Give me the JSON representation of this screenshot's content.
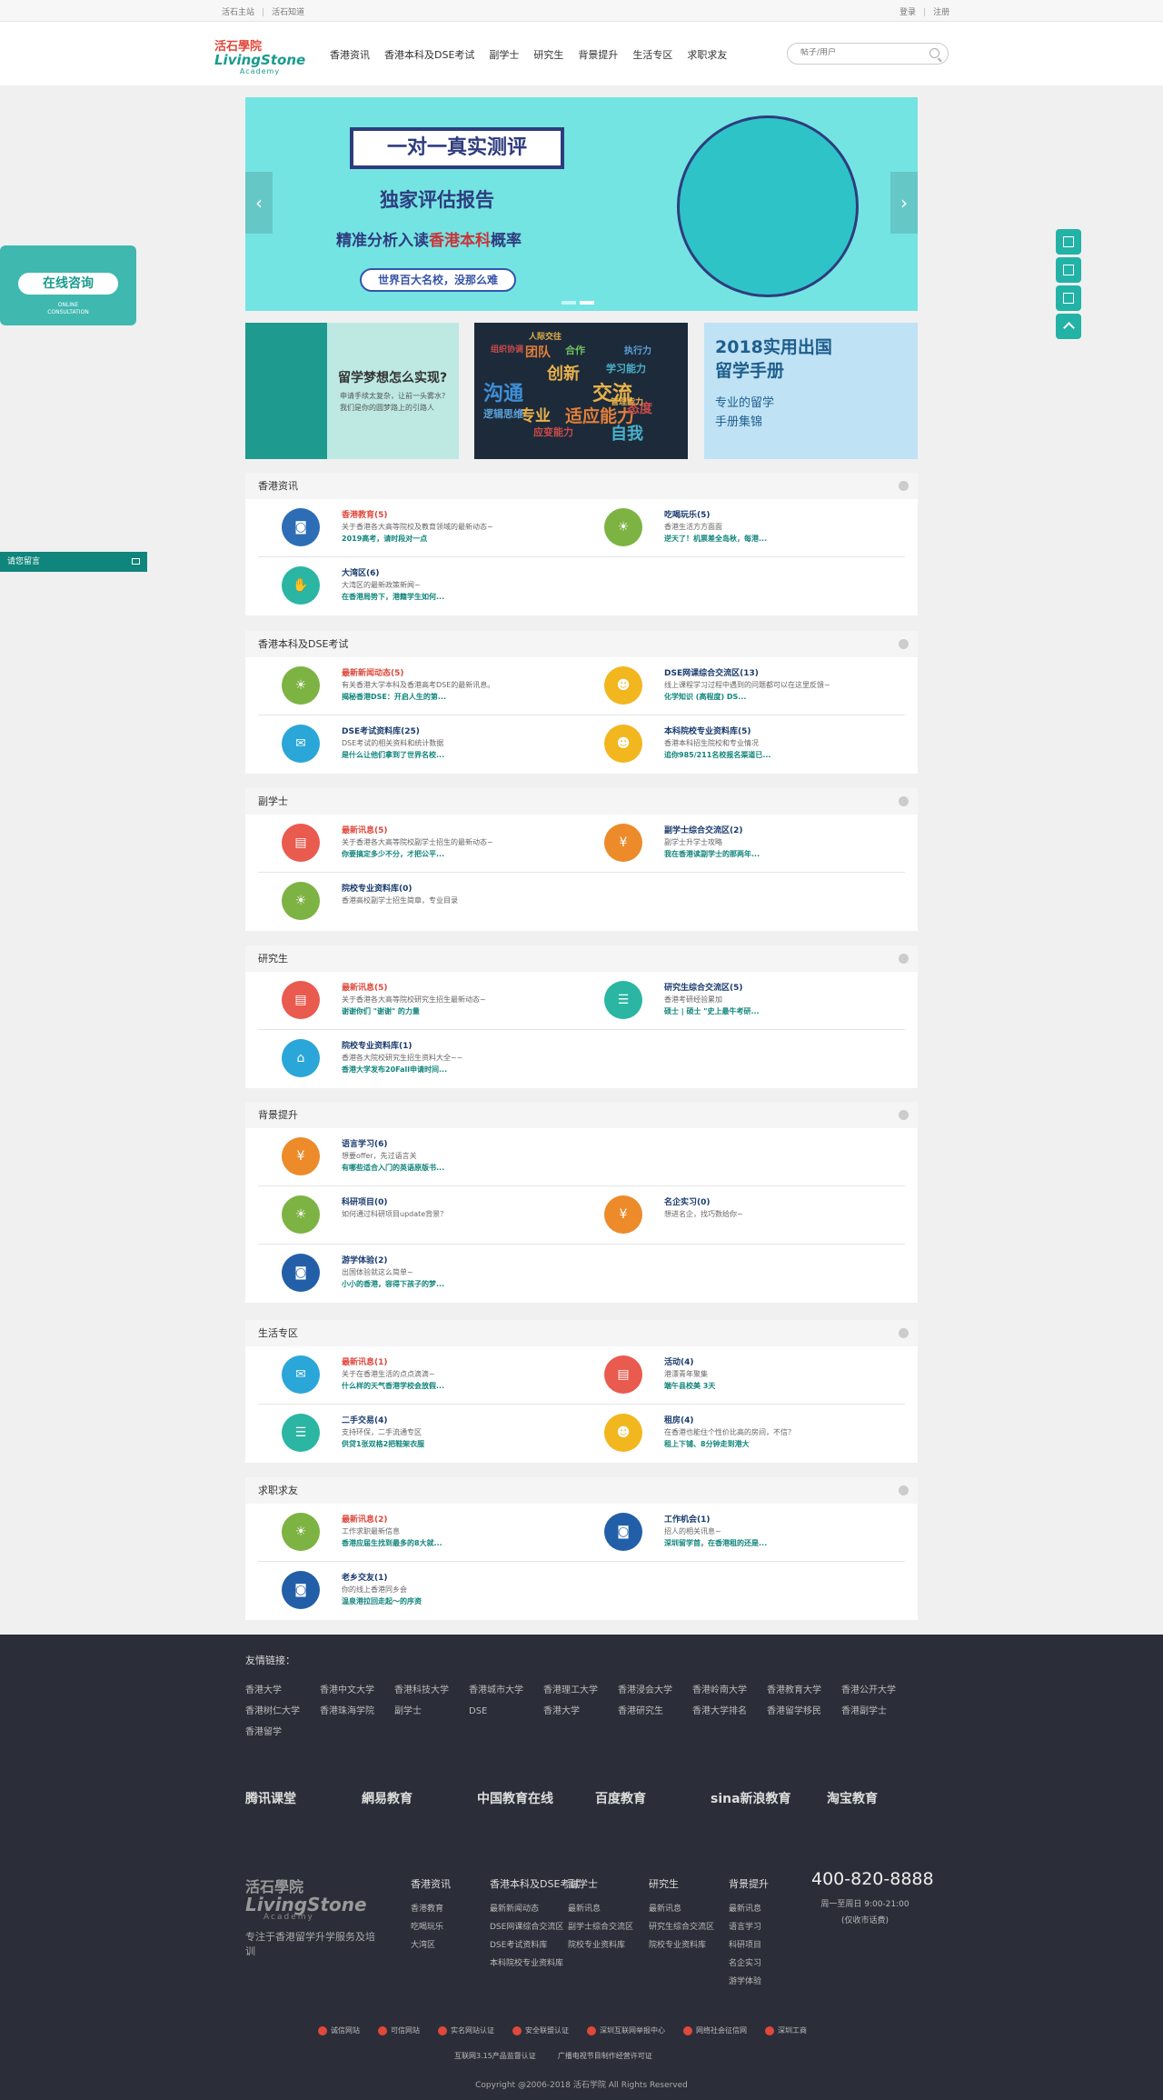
{
  "topbar": {
    "left1": "活石主站",
    "left2": "活石知道",
    "login": "登录",
    "register": "注册"
  },
  "logo": {
    "line1": "活石學院",
    "line2": "LivingStone",
    "line3": "Academy"
  },
  "nav": [
    "香港资讯",
    "香港本科及DSE考试",
    "副学士",
    "研究生",
    "背景提升",
    "生活专区",
    "求职求友"
  ],
  "search": {
    "placeholder": "帖子/用户"
  },
  "banner": {
    "title": "一对一真实测评",
    "line2": "独家评估报告",
    "line3_a": "精准分析入读",
    "line3_b": "香港本科",
    "line3_c": "概率",
    "button": "世界百大名校，没那么难"
  },
  "cards": {
    "card1_title": "留学梦想怎么实现?",
    "card1_desc": "申请手续太复杂，让前一头雾水?我们是你的圆梦路上的引路人",
    "card2_words": [
      "人际交往",
      "组织协调",
      "团队",
      "执行力",
      "创新",
      "学习能力",
      "沟通",
      "交流",
      "专业",
      "适应能力",
      "态度",
      "自我",
      "逻辑思维",
      "管理能力",
      "应变能力",
      "合作"
    ],
    "card3_t1": "2018实用出国",
    "card3_t2": "留学手册",
    "card3_t3": "专业的留学",
    "card3_t4": "手册集锦"
  },
  "side": {
    "consult": "在线咨询",
    "consult_sub1": "ONLINE",
    "consult_sub2": "CONSULTATION",
    "msg": "请您留言"
  },
  "sections": [
    {
      "title": "香港资讯",
      "rows": [
        [
          {
            "title": "香港教育(5)",
            "red": true,
            "desc": "关于香港各大高等院校及教育领域的最新动态~",
            "link": "2019高考，请时段对一点",
            "color": "c-blue",
            "icon": "◙"
          },
          {
            "title": "吃喝玩乐(5)",
            "red": false,
            "desc": "香港生活方方面面",
            "link": "逆天了！机票差全岛秋，每港...",
            "color": "c-green",
            "icon": "☀"
          }
        ],
        [
          {
            "title": "大湾区(6)",
            "red": false,
            "desc": "大湾区的最新政策新闻~",
            "link": "在香港局势下，港籍学生如何...",
            "color": "c-teal",
            "icon": "✋"
          }
        ]
      ]
    },
    {
      "title": "香港本科及DSE考试",
      "rows": [
        [
          {
            "title": "最新新闻动态(5)",
            "red": true,
            "desc": "有关香港大学本科及香港高考DSE的最新讯息。",
            "link": "揭秘香港DSE：开启人生的第...",
            "color": "c-green",
            "icon": "☀"
          },
          {
            "title": "DSE网课综合交流区(13)",
            "red": false,
            "desc": "线上课程学习过程中遇到的问题都可以在这里反馈~",
            "link": "化学知识 (高程度) DS...",
            "color": "c-yellow",
            "icon": "☻"
          }
        ],
        [
          {
            "title": "DSE考试资料库(25)",
            "red": false,
            "desc": "DSE考试的相关资料和统计数据",
            "link": "是什么让他们拿到了世界名校...",
            "color": "c-cyan",
            "icon": "✉"
          },
          {
            "title": "本科院校专业资料库(5)",
            "red": false,
            "desc": "香港本科招生院校和专业情况",
            "link": "追你985/211名校报名渠道已...",
            "color": "c-yellow",
            "icon": "☻"
          }
        ]
      ]
    },
    {
      "title": "副学士",
      "rows": [
        [
          {
            "title": "最新讯息(5)",
            "red": true,
            "desc": "关于香港各大高等院校副学士招生的最新动态~",
            "link": "你要搞定多少不分，才把公平...",
            "color": "c-red",
            "icon": "▤"
          },
          {
            "title": "副学士综合交流区(2)",
            "red": false,
            "desc": "副学士升学士攻略",
            "link": "我在香港读副学士的那两年...",
            "color": "c-orange",
            "icon": "¥"
          }
        ],
        [
          {
            "title": "院校专业资料库(0)",
            "red": false,
            "desc": "香港高校副学士招生简章，专业目录",
            "link": "",
            "color": "c-green",
            "icon": "☀"
          }
        ]
      ]
    },
    {
      "title": "研究生",
      "rows": [
        [
          {
            "title": "最新讯息(5)",
            "red": true,
            "desc": "关于香港各大高等院校研究生招生最新动态~",
            "link": "谢谢你们 \"谢谢\" 的力量",
            "color": "c-red",
            "icon": "▤"
          },
          {
            "title": "研究生综合交流区(5)",
            "red": false,
            "desc": "香港考研经验累加",
            "link": "硕士 | 硕士 \"史上最牛考研...",
            "color": "c-teal",
            "icon": "☰"
          }
        ],
        [
          {
            "title": "院校专业资料库(1)",
            "red": false,
            "desc": "香港各大院校研究生招生资料大全~~",
            "link": "香港大学发布20Fall申请时间...",
            "color": "c-cyan",
            "icon": "⌂"
          }
        ]
      ]
    },
    {
      "title": "背景提升",
      "rows": [
        [
          {
            "title": "语言学习(6)",
            "red": false,
            "desc": "想要offer，先过语言关",
            "link": "有哪些适合入门的英语原版书...",
            "color": "c-orange",
            "icon": "¥"
          }
        ],
        [
          {
            "title": "科研项目(0)",
            "red": false,
            "desc": "如何通过科研项目update背景？",
            "link": "",
            "color": "c-green",
            "icon": "☀"
          },
          {
            "title": "名企实习(0)",
            "red": false,
            "desc": "想进名企，找巧数给你~",
            "link": "",
            "color": "c-orange",
            "icon": "¥"
          }
        ],
        [
          {
            "title": "游学体验(2)",
            "red": false,
            "desc": "出国体验就这么简单~",
            "link": "小小的香港，容得下孩子的梦...",
            "color": "c-dblue",
            "icon": "◙"
          }
        ]
      ]
    },
    {
      "title": "生活专区",
      "rows": [
        [
          {
            "title": "最新讯息(1)",
            "red": true,
            "desc": "关于在香港生活的点点滴滴~",
            "link": "什么样的天气香港学校会放假...",
            "color": "c-cyan",
            "icon": "✉"
          },
          {
            "title": "活动(4)",
            "red": false,
            "desc": "港漂青年聚集",
            "link": "端午县校美 3天",
            "color": "c-red",
            "icon": "▤"
          }
        ],
        [
          {
            "title": "二手交易(4)",
            "red": false,
            "desc": "支持环保，二手流通专区",
            "link": "供贷1张双格2把鞋架衣服",
            "color": "c-teal",
            "icon": "☰"
          },
          {
            "title": "租房(4)",
            "red": false,
            "desc": "在香港也能住个性价比高的房间，不信？",
            "link": "租上下铺、8分钟走到港大",
            "color": "c-yellow",
            "icon": "☻"
          }
        ]
      ]
    },
    {
      "title": "求职求友",
      "rows": [
        [
          {
            "title": "最新讯息(2)",
            "red": true,
            "desc": "工作求职最新信息",
            "link": "香港应届生找到最多的8大就...",
            "color": "c-green",
            "icon": "☀"
          },
          {
            "title": "工作机会(1)",
            "red": false,
            "desc": "招人的相关讯息~",
            "link": "深圳留学首，在香港租的还是...",
            "color": "c-dblue",
            "icon": "◙"
          }
        ],
        [
          {
            "title": "老乡交友(1)",
            "red": false,
            "desc": "你的线上香港同乡会",
            "link": "温泉港拉回走起～的序资",
            "color": "c-dblue",
            "icon": "◙"
          }
        ]
      ]
    }
  ],
  "footer": {
    "friend_links_label": "友情链接：",
    "links": [
      "香港大学",
      "香港中文大学",
      "香港科技大学",
      "香港城市大学",
      "香港理工大学",
      "香港浸会大学",
      "香港岭南大学",
      "香港教育大学",
      "香港公开大学",
      "香港树仁大学",
      "香港珠海学院",
      "副学士",
      "DSE",
      "香港大学",
      "香港研究生",
      "香港大学排名",
      "香港留学移民",
      "香港副学士",
      "香港留学"
    ],
    "partners": [
      "腾讯课堂",
      "網易教育",
      "中国教育在线",
      "百度教育",
      "sina新浪教育",
      "淘宝教育"
    ],
    "logo_a": "活石學院",
    "logo_b": "LivingStone",
    "logo_c": "Academy",
    "slogan": "专注于香港留学升学服务及培训",
    "cols": [
      {
        "h": "香港资讯",
        "items": [
          "香港教育",
          "吃喝玩乐",
          "大湾区"
        ]
      },
      {
        "h": "香港本科及DSE考试",
        "items": [
          "最新新闻动态",
          "DSE网课综合交流区",
          "DSE考试资料库",
          "本科院校专业资料库"
        ]
      },
      {
        "h": "副学士",
        "items": [
          "最新讯息",
          "副学士综合交流区",
          "院校专业资料库"
        ]
      },
      {
        "h": "研究生",
        "items": [
          "最新讯息",
          "研究生综合交流区",
          "院校专业资料库"
        ]
      },
      {
        "h": "背景提升",
        "items": [
          "最新讯息",
          "语言学习",
          "科研项目",
          "名企实习",
          "游学体验"
        ]
      }
    ],
    "phone": "400-820-8888",
    "hours": "周一至周日 9:00-21:00",
    "hours_note": "(仅收市话费)",
    "badges": [
      "诚信网站",
      "可信网站",
      "实名网站认证",
      "安全联盟认证",
      "深圳互联网举报中心",
      "网络社会征信网",
      "深圳工商"
    ],
    "badges2": [
      "互联网3.15产品监督认证",
      "广播电视节目制作经营许可证"
    ],
    "copyright": "Copyright @2006-2018 活石学院 All Rights Reserved"
  }
}
